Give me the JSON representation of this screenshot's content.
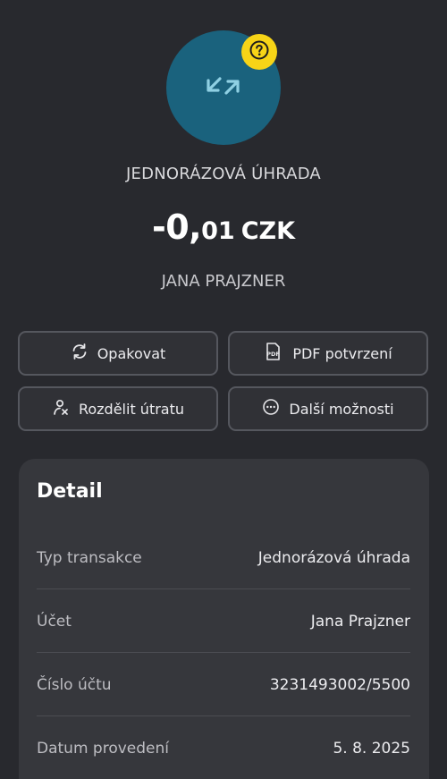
{
  "header": {
    "icon": "transfer-arrows-icon",
    "badge_icon": "question-icon",
    "transaction_type": "JEDNORÁZOVÁ ÚHRADA",
    "amount_major": "-0,",
    "amount_minor": "01",
    "currency": "CZK",
    "payee": "JANA PRAJZNER"
  },
  "actions": {
    "repeat": "Opakovat",
    "pdf": "PDF potvrzení",
    "split": "Rozdělit útratu",
    "more": "Další možnosti"
  },
  "detail": {
    "title": "Detail",
    "rows": [
      {
        "label": "Typ transakce",
        "value": "Jednorázová úhrada"
      },
      {
        "label": "Účet",
        "value": "Jana Prajzner"
      },
      {
        "label": "Číslo účtu",
        "value": "3231493002/5500"
      },
      {
        "label": "Datum provedení",
        "value": "5. 8. 2025"
      }
    ]
  },
  "colors": {
    "background": "#28292e",
    "avatar": "#1a627d",
    "badge": "#f7d417",
    "card": "#36373c"
  }
}
